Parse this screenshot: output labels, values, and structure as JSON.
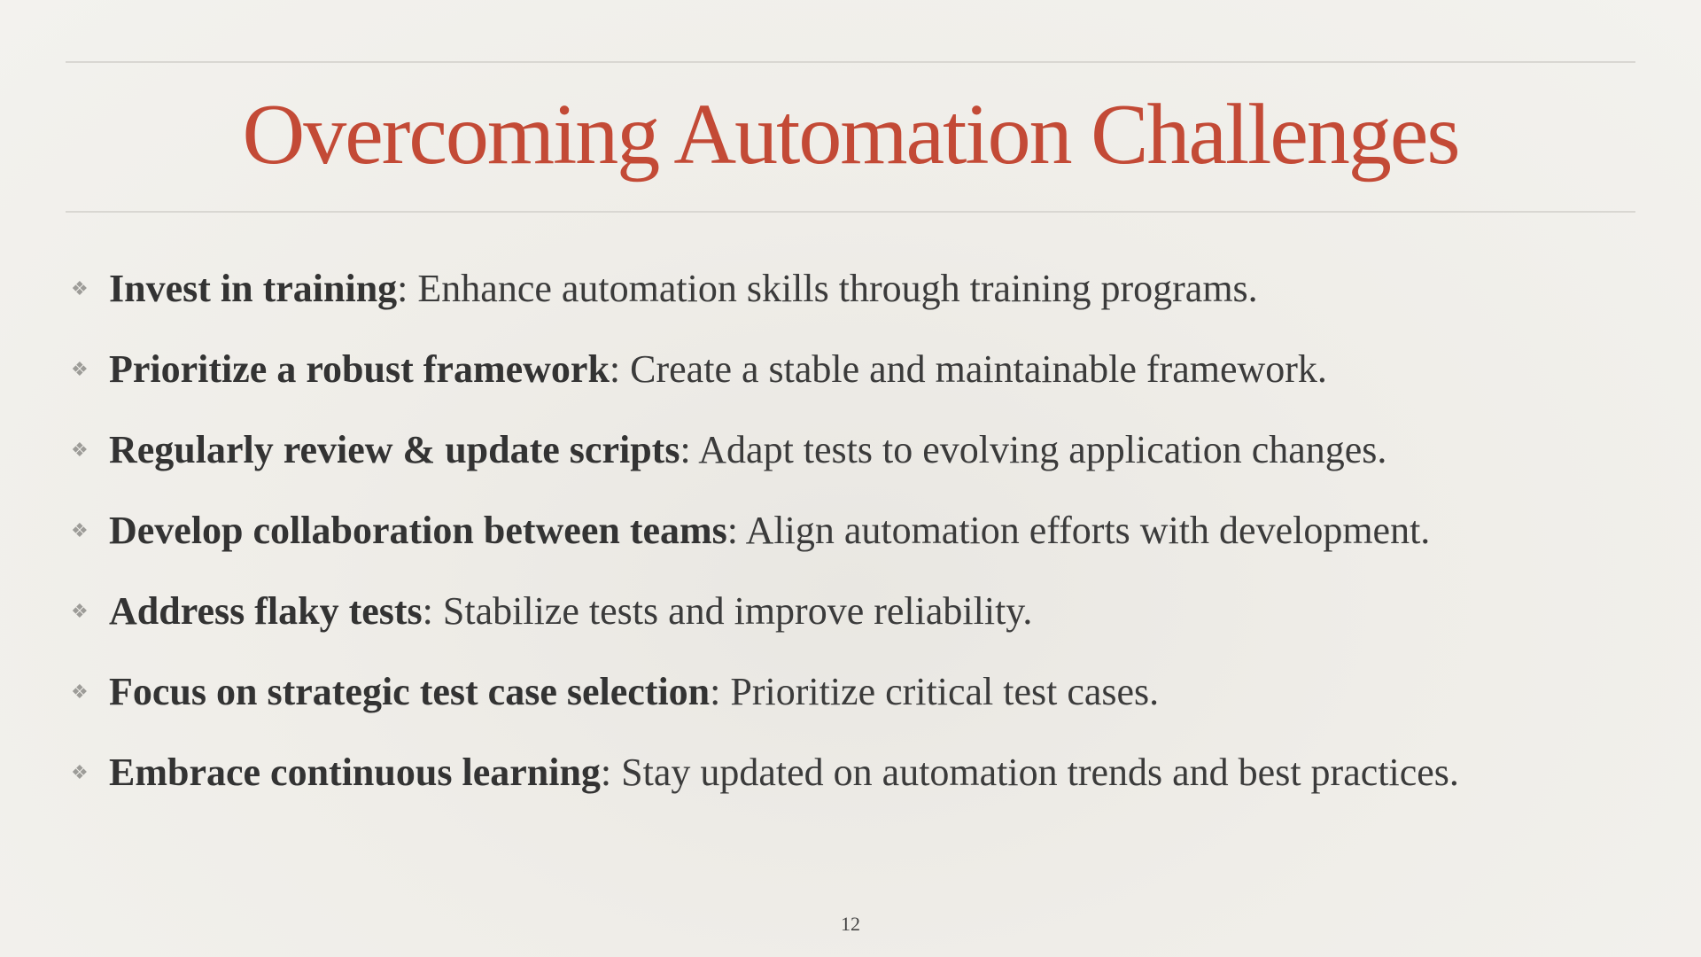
{
  "slide": {
    "title": "Overcoming Automation Challenges",
    "page_number": "12",
    "bullet_icon": "diamond-flourish-icon",
    "accent_color": "#c34a36",
    "text_color": "#3b3b3b",
    "bullets": [
      {
        "term": "Invest in training",
        "separator": ":",
        "text": " Enhance automation skills through training programs."
      },
      {
        "term": "Prioritize a robust framework",
        "separator": ":",
        "text": " Create a stable and maintainable framework."
      },
      {
        "term": "Regularly review & update scripts",
        "separator": ":",
        "text": " Adapt tests to evolving application changes."
      },
      {
        "term": "Develop collaboration between teams",
        "separator": ":",
        "text": " Align automation efforts with development."
      },
      {
        "term": "Address flaky tests",
        "separator": ":",
        "text": " Stabilize tests and improve reliability."
      },
      {
        "term": "Focus on strategic test case selection",
        "separator": ":",
        "text": " Prioritize critical test cases."
      },
      {
        "term": "Embrace continuous learning",
        "separator": ":",
        "text": " Stay updated on automation trends and best practices."
      }
    ]
  }
}
